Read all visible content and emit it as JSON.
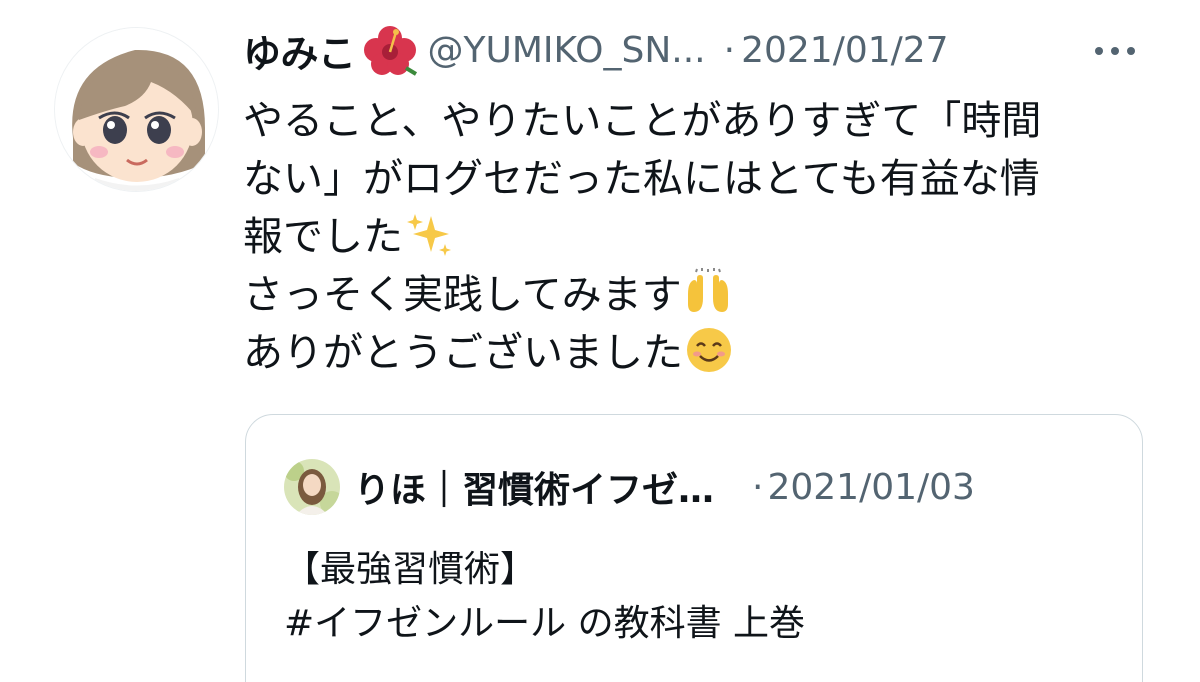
{
  "tweet": {
    "display_name": "ゆみこ",
    "name_emoji": "hibiscus-emoji",
    "handle": "@YUMIKO_SN...",
    "separator": "·",
    "date": "2021/01/27",
    "more_icon": "more-icon",
    "text_lines": [
      "やること、やりたいことがありすぎて「時間",
      "ない」がログセだった私にはとても有益な情",
      "報でした",
      "さっそく実践してみます",
      "ありがとうございました"
    ],
    "line_emojis": [
      "",
      "",
      "sparkles-emoji",
      "raising-hands-emoji",
      "smiling-face-emoji"
    ]
  },
  "quoted_tweet": {
    "display_name": "りほ｜習慣術イフゼ…",
    "separator": "·",
    "date": "2021/01/03",
    "text_lines": [
      "【最強習慣術】",
      "#イフゼンルール の教科書 上巻"
    ]
  },
  "colors": {
    "text_primary": "#0f1419",
    "text_secondary": "#536471",
    "card_border": "#cfd9de"
  }
}
